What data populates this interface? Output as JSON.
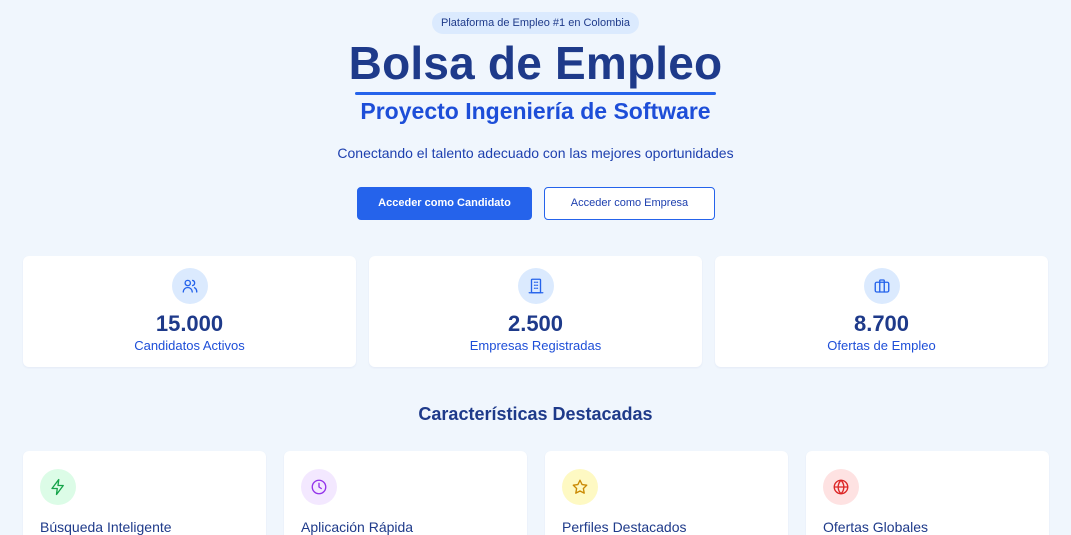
{
  "hero": {
    "badge": "Plataforma de Empleo #1 en Colombia",
    "title": "Bolsa de Empleo",
    "subtitle": "Proyecto Ingeniería de Software",
    "tagline": "Conectando el talento adecuado con las mejores oportunidades",
    "primary_button": "Acceder como Candidato",
    "secondary_button": "Acceder como Empresa"
  },
  "stats": [
    {
      "icon": "users-icon",
      "value": "15.000",
      "label": "Candidatos Activos"
    },
    {
      "icon": "building-icon",
      "value": "2.500",
      "label": "Empresas Registradas"
    },
    {
      "icon": "briefcase-icon",
      "value": "8.700",
      "label": "Ofertas de Empleo"
    }
  ],
  "features": {
    "title": "Características Destacadas",
    "items": [
      {
        "icon": "lightning-icon",
        "title": "Búsqueda Inteligente",
        "color": "#16a34a",
        "bg": "#dcfce7"
      },
      {
        "icon": "clock-icon",
        "title": "Aplicación Rápida",
        "color": "#9333ea",
        "bg": "#f3e8ff"
      },
      {
        "icon": "star-icon",
        "title": "Perfiles Destacados",
        "color": "#ca8a04",
        "bg": "#fef9c3"
      },
      {
        "icon": "globe-icon",
        "title": "Ofertas Globales",
        "color": "#dc2626",
        "bg": "#fee2e2"
      }
    ]
  },
  "colors": {
    "background": "#f0f6fd",
    "primary": "#2563eb",
    "heading": "#1e3a8a"
  }
}
